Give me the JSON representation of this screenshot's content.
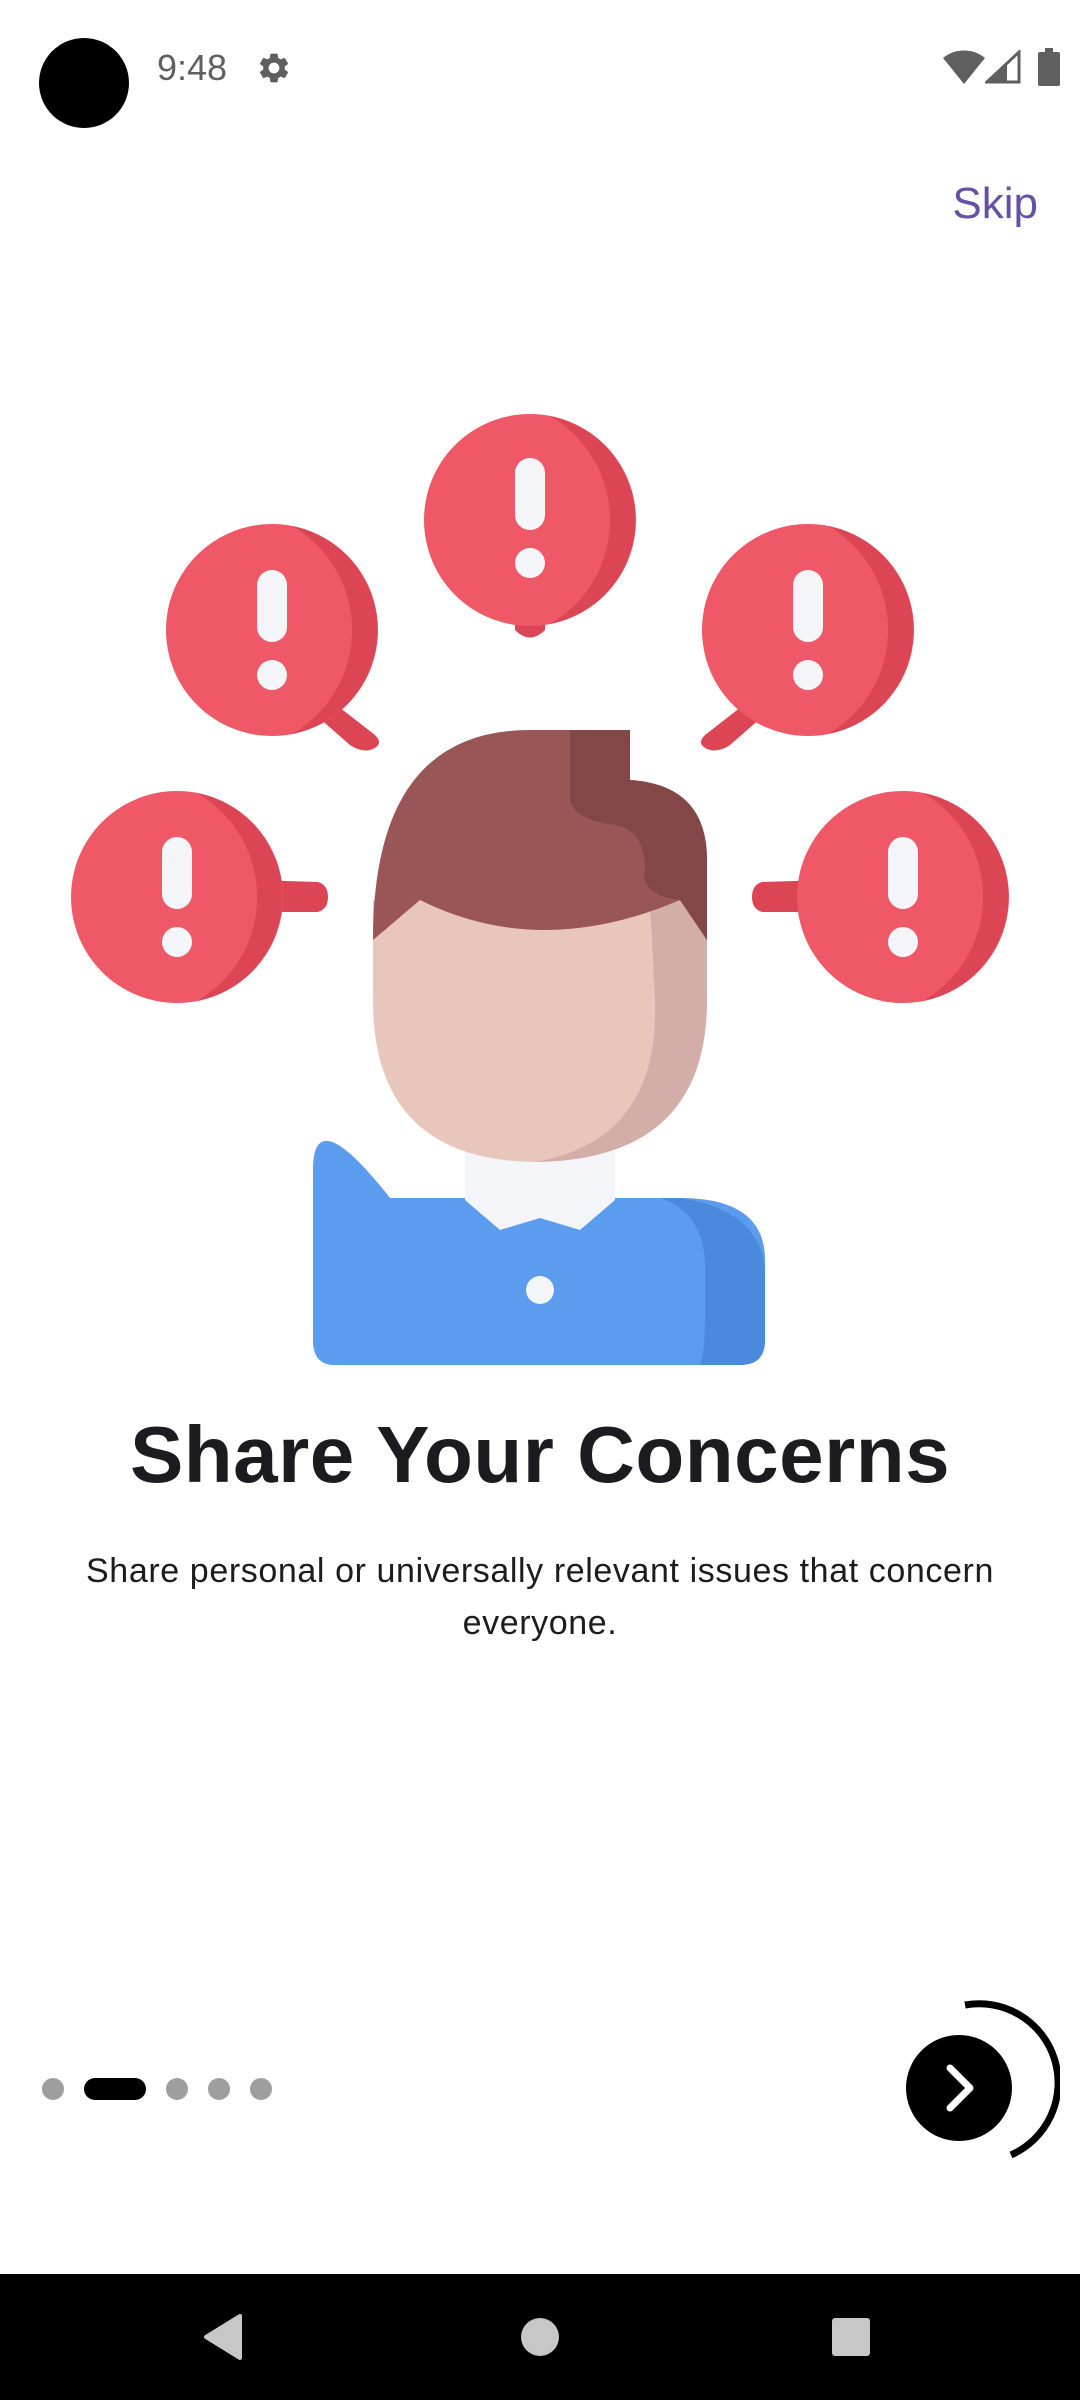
{
  "status_bar": {
    "time": "9:48",
    "icons": [
      "settings-gear-icon",
      "wifi-icon",
      "cellular-signal-icon",
      "battery-icon"
    ]
  },
  "onboarding": {
    "skip_label": "Skip",
    "title": "Share Your Concerns",
    "description": "Share personal or universally relevant issues that concern everyone.",
    "page_indicator": {
      "total": 5,
      "current": 2
    },
    "next_button_icon": "chevron-right-icon",
    "illustration": "person-with-alert-speech-bubbles"
  },
  "nav_bar": {
    "icons": [
      "back-icon",
      "home-icon",
      "recents-icon"
    ]
  },
  "colors": {
    "skip": "#6750a4",
    "title": "#1c1b1f",
    "bubble": "#ef5866",
    "bubble_shade": "#dc4553",
    "hair": "#9a5656",
    "hair_shade": "#844747",
    "face": "#e9c6bb",
    "face_shade": "#d3aea8",
    "shirt": "#5c9cee",
    "shirt_shade": "#4a89db",
    "dot_inactive": "#9e9e9e",
    "dot_active": "#000000"
  }
}
